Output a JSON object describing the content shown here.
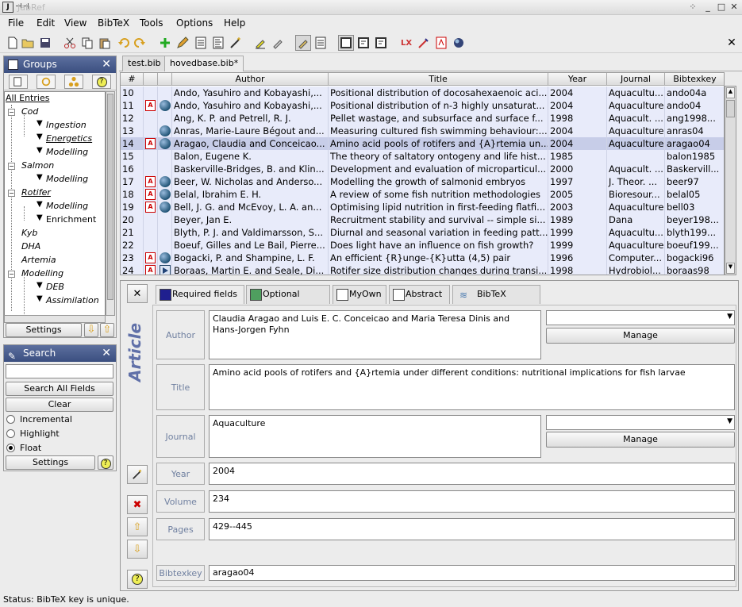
{
  "window": {
    "title": "JabRef"
  },
  "menubar": [
    "File",
    "Edit",
    "View",
    "BibTeX",
    "Tools",
    "Options",
    "Help"
  ],
  "groups": {
    "title": "Groups",
    "settings": "Settings",
    "items": [
      {
        "label": "All Entries"
      },
      {
        "label": "Cod"
      },
      {
        "label": "Ingestion"
      },
      {
        "label": "Energetics"
      },
      {
        "label": "Modelling"
      },
      {
        "label": "Salmon"
      },
      {
        "label": "Modelling"
      },
      {
        "label": "Rotifer"
      },
      {
        "label": "Modelling"
      },
      {
        "label": "Enrichment"
      },
      {
        "label": "Kyb"
      },
      {
        "label": "DHA"
      },
      {
        "label": "Artemia"
      },
      {
        "label": "Modelling"
      },
      {
        "label": "DEB"
      },
      {
        "label": "Assimilation"
      }
    ]
  },
  "search": {
    "title": "Search",
    "value": "",
    "search_all": "Search All Fields",
    "clear": "Clear",
    "incremental": "Incremental",
    "highlight": "Highlight",
    "float": "Float",
    "settings": "Settings"
  },
  "file_tabs": [
    "test.bib",
    "hovedbase.bib*"
  ],
  "table": {
    "columns": [
      "#",
      "",
      "",
      "Author",
      "Title",
      "Year",
      "Journal",
      "Bibtexkey"
    ],
    "rows": [
      {
        "n": "10",
        "pdf": false,
        "www": false,
        "author": "Ando, Yasuhiro and Kobayashi,...",
        "title": "Positional distribution of docosahexaenoic aci...",
        "year": "2004",
        "journal": "Aquacultu...",
        "key": "ando04a"
      },
      {
        "n": "11",
        "pdf": true,
        "www": true,
        "author": "Ando, Yasuhiro and Kobayashi,...",
        "title": "Positional distribution of n-3 highly unsaturat...",
        "year": "2004",
        "journal": "Aquaculture",
        "key": "ando04"
      },
      {
        "n": "12",
        "pdf": false,
        "www": false,
        "author": "Ang, K. P. and Petrell, R. J.",
        "title": "Pellet wastage, and subsurface and surface f...",
        "year": "1998",
        "journal": "Aquacult. ...",
        "key": "ang1998..."
      },
      {
        "n": "13",
        "pdf": false,
        "www": true,
        "author": "Anras, Marie-Laure Bégout and...",
        "title": "Measuring cultured fish swimming behaviour:...",
        "year": "2004",
        "journal": "Aquaculture",
        "key": "anras04"
      },
      {
        "n": "14",
        "pdf": true,
        "www": true,
        "author": "Aragao, Claudia and Conceicao...",
        "title": "Amino acid pools of rotifers and {A}rtemia un...",
        "year": "2004",
        "journal": "Aquaculture",
        "key": "aragao04",
        "selected": true
      },
      {
        "n": "15",
        "pdf": false,
        "www": false,
        "author": "Balon, Eugene K.",
        "title": "The theory of saltatory ontogeny and life hist...",
        "year": "1985",
        "journal": "",
        "key": "balon1985"
      },
      {
        "n": "16",
        "pdf": false,
        "www": false,
        "author": "Baskerville-Bridges, B. and Klin...",
        "title": "Development and evaluation of microparticul...",
        "year": "2000",
        "journal": "Aquacult. ...",
        "key": "Baskervill..."
      },
      {
        "n": "17",
        "pdf": true,
        "www": true,
        "author": "Beer, W. Nicholas and Anderso...",
        "title": "Modelling the growth of salmonid embryos",
        "year": "1997",
        "journal": "J. Theor. ...",
        "key": "beer97"
      },
      {
        "n": "18",
        "pdf": true,
        "www": true,
        "author": "Belal, Ibrahim E. H.",
        "title": "A review of some fish nutrition methodologies",
        "year": "2005",
        "journal": "Bioresour...",
        "key": "belal05"
      },
      {
        "n": "19",
        "pdf": true,
        "www": true,
        "author": "Bell, J. G. and McEvoy, L. A. an...",
        "title": "Optimising lipid nutrition in first-feeding flatfi...",
        "year": "2003",
        "journal": "Aquaculture",
        "key": "bell03"
      },
      {
        "n": "20",
        "pdf": false,
        "www": false,
        "author": "Beyer, Jan E.",
        "title": "Recruitment stability and survival -- simple si...",
        "year": "1989",
        "journal": "Dana",
        "key": "beyer198..."
      },
      {
        "n": "21",
        "pdf": false,
        "www": false,
        "author": "Blyth, P. J. and Valdimarsson, S...",
        "title": "Diurnal and seasonal variation in feeding patt...",
        "year": "1999",
        "journal": "Aquacultu...",
        "key": "blyth199..."
      },
      {
        "n": "22",
        "pdf": false,
        "www": false,
        "author": "Boeuf, Gilles and Le Bail, Pierre...",
        "title": "Does light have an influence on fish growth?",
        "year": "1999",
        "journal": "Aquaculture",
        "key": "boeuf199..."
      },
      {
        "n": "23",
        "pdf": true,
        "www": true,
        "author": "Bogacki, P. and Shampine, L. F.",
        "title": "An efficient {R}unge-{K}utta (4,5) pair",
        "year": "1996",
        "journal": "Computer...",
        "key": "bogacki96"
      },
      {
        "n": "24",
        "pdf": true,
        "www": false,
        "play": true,
        "author": "Boraas, Martin E. and Seale, Di...",
        "title": "Rotifer size distribution changes during transi...",
        "year": "1998",
        "journal": "Hydrobiol...",
        "key": "boraas98"
      }
    ]
  },
  "editor": {
    "type": "Article",
    "tabs": [
      {
        "label": "Required fields",
        "color": "#1f1f8f"
      },
      {
        "label": "Optional fields",
        "color": "#4f9f5f"
      },
      {
        "label": "MyOwn",
        "color": "#ffffff"
      },
      {
        "label": "Abstract",
        "color": "#ffffff"
      },
      {
        "label": "BibTeX source",
        "color": ""
      }
    ],
    "fields": {
      "author_label": "Author",
      "author": "Claudia Aragao and Luis E. C. Conceicao and Maria Teresa Dinis and Hans-Jorgen Fyhn",
      "title_label": "Title",
      "title": "Amino acid pools of rotifers and {A}rtemia under different conditions: nutritional implications for fish larvae",
      "journal_label": "Journal",
      "journal": "Aquaculture",
      "year_label": "Year",
      "year": "2004",
      "volume_label": "Volume",
      "volume": "234",
      "pages_label": "Pages",
      "pages": "429--445",
      "key_label": "Bibtexkey",
      "key": "aragao04"
    },
    "manage": "Manage"
  },
  "status": {
    "label": "Status:",
    "text": "BibTeX key is unique."
  }
}
